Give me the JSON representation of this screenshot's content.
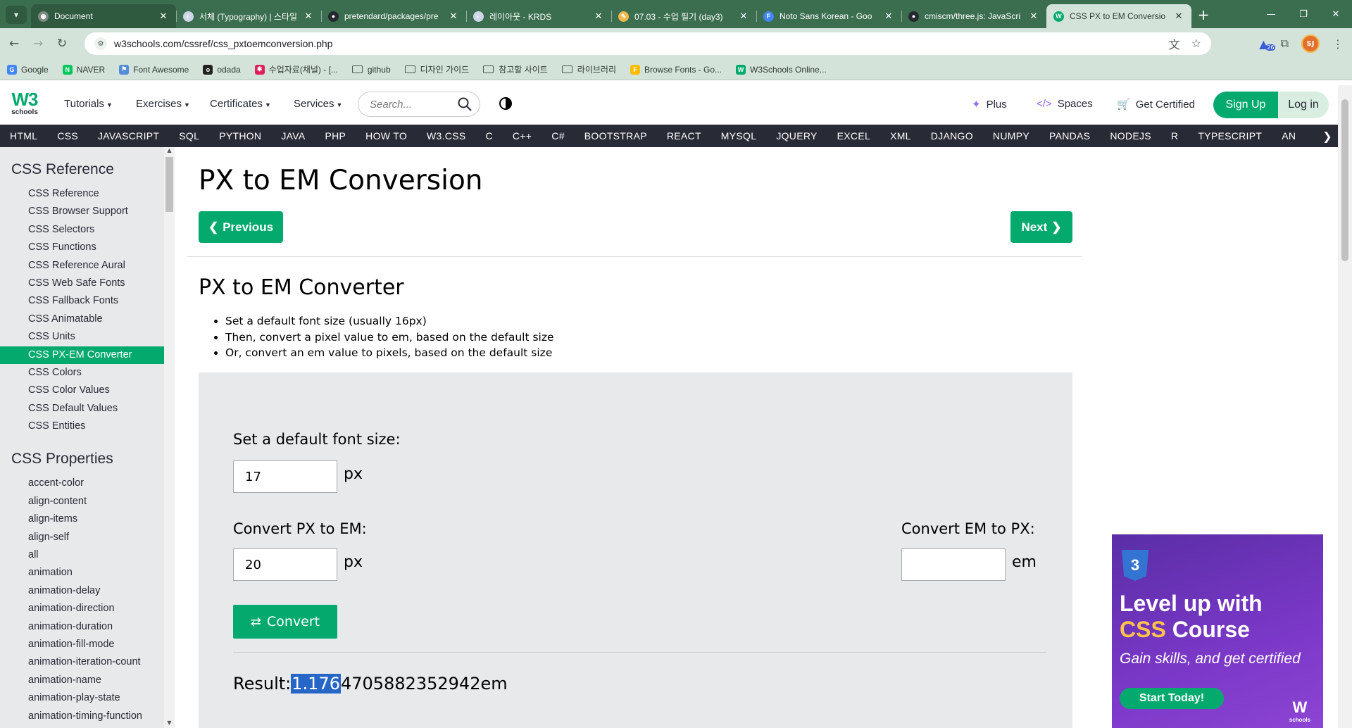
{
  "browser": {
    "tabs": [
      {
        "title": "Document",
        "favicon": "globe-icon",
        "color": "#7d8b82",
        "glyph": "◉"
      },
      {
        "title": "서체 (Typography) | 스타일",
        "favicon": "krds-icon",
        "color": "#cfd6e8",
        "glyph": "◐"
      },
      {
        "title": "pretendard/packages/pre",
        "favicon": "github-icon",
        "color": "#24292f",
        "glyph": "●"
      },
      {
        "title": "레이아웃 - KRDS",
        "favicon": "krds-icon",
        "color": "#cfd6e8",
        "glyph": "◐"
      },
      {
        "title": "07.03 - 수업 필기 (day3)",
        "favicon": "pencil-icon",
        "color": "#f2b84b",
        "glyph": "✎"
      },
      {
        "title": "Noto Sans Korean - Goo",
        "favicon": "google-fonts-icon",
        "color": "#4285f4",
        "glyph": "F"
      },
      {
        "title": "cmiscm/three.js: JavaScri",
        "favicon": "github-icon",
        "color": "#24292f",
        "glyph": "●"
      },
      {
        "title": "CSS PX to EM Conversio",
        "favicon": "w3schools-icon",
        "color": "#04aa6d",
        "glyph": "W"
      }
    ],
    "url": "w3schools.com/cssref/css_pxtoemconversion.php",
    "profile_initials": "SJ",
    "extension_badge": "26",
    "bookmarks": [
      {
        "label": "Google",
        "type": "site",
        "color": "#4285f4",
        "glyph": "G"
      },
      {
        "label": "NAVER",
        "type": "site",
        "color": "#03c75a",
        "glyph": "N"
      },
      {
        "label": "Font Awesome",
        "type": "site",
        "color": "#538dd7",
        "glyph": "⚑"
      },
      {
        "label": "odada",
        "type": "site",
        "color": "#222222",
        "glyph": "o"
      },
      {
        "label": "수업자료(채널) - [...",
        "type": "site",
        "color": "#e01e5a",
        "glyph": "✱"
      },
      {
        "label": "github",
        "type": "folder"
      },
      {
        "label": "디자인 가이드",
        "type": "folder"
      },
      {
        "label": "참고할 사이트",
        "type": "folder"
      },
      {
        "label": "라이브러리",
        "type": "folder"
      },
      {
        "label": "Browse Fonts - Go...",
        "type": "site",
        "color": "#fbbc04",
        "glyph": "F"
      },
      {
        "label": "W3Schools Online...",
        "type": "site",
        "color": "#04aa6d",
        "glyph": "W"
      }
    ]
  },
  "w3": {
    "logo": "W3",
    "logo_sup": "3",
    "logo_sub": "schools",
    "nav": {
      "tutorials": "Tutorials",
      "exercises": "Exercises",
      "certificates": "Certificates",
      "services": "Services"
    },
    "search_placeholder": "Search...",
    "plus": "Plus",
    "spaces": "Spaces",
    "get_certified": "Get Certified",
    "sign_up": "Sign Up",
    "log_in": "Log in",
    "subjects": [
      "HTML",
      "CSS",
      "JAVASCRIPT",
      "SQL",
      "PYTHON",
      "JAVA",
      "PHP",
      "HOW TO",
      "W3.CSS",
      "C",
      "C++",
      "C#",
      "BOOTSTRAP",
      "REACT",
      "MYSQL",
      "JQUERY",
      "EXCEL",
      "XML",
      "DJANGO",
      "NUMPY",
      "PANDAS",
      "NODEJS",
      "R",
      "TYPESCRIPT",
      "AN"
    ]
  },
  "sidebar": {
    "reference_heading": "CSS Reference",
    "reference_links": [
      "CSS Reference",
      "CSS Browser Support",
      "CSS Selectors",
      "CSS Functions",
      "CSS Reference Aural",
      "CSS Web Safe Fonts",
      "CSS Fallback Fonts",
      "CSS Animatable",
      "CSS Units",
      "CSS PX-EM Converter",
      "CSS Colors",
      "CSS Color Values",
      "CSS Default Values",
      "CSS Entities"
    ],
    "active_link": "CSS PX-EM Converter",
    "properties_heading": "CSS Properties",
    "property_links": [
      "accent-color",
      "align-content",
      "align-items",
      "align-self",
      "all",
      "animation",
      "animation-delay",
      "animation-direction",
      "animation-duration",
      "animation-fill-mode",
      "animation-iteration-count",
      "animation-name",
      "animation-play-state",
      "animation-timing-function"
    ]
  },
  "main": {
    "title": "PX to EM Conversion",
    "prev": "Previous",
    "next": "Next",
    "converter_title": "PX to EM Converter",
    "bullets": [
      "Set a default font size (usually 16px)",
      "Then, convert a pixel value to em, based on the default size",
      "Or, convert an em value to pixels, based on the default size"
    ],
    "default_label": "Set a default font size:",
    "default_value": "17",
    "px_unit": "px",
    "px_to_em_label": "Convert PX to EM:",
    "px_value": "20",
    "em_to_px_label": "Convert EM to PX:",
    "em_value": "",
    "em_unit": "em",
    "convert": "Convert",
    "result_label": "Result:",
    "result_selected": "1.176",
    "result_rest": "4705882352942em"
  },
  "ad": {
    "line1": "Level up with",
    "line2_highlight": "CSS",
    "line2_rest": "Course",
    "subtitle": "Gain skills, and get certified",
    "cta": "Start Today!",
    "badge": "3"
  },
  "colors": {
    "brand_green": "#04aa6d",
    "dark_nav": "#282a35",
    "browser_frame": "#3b6e4f",
    "selection": "#2566c7"
  }
}
